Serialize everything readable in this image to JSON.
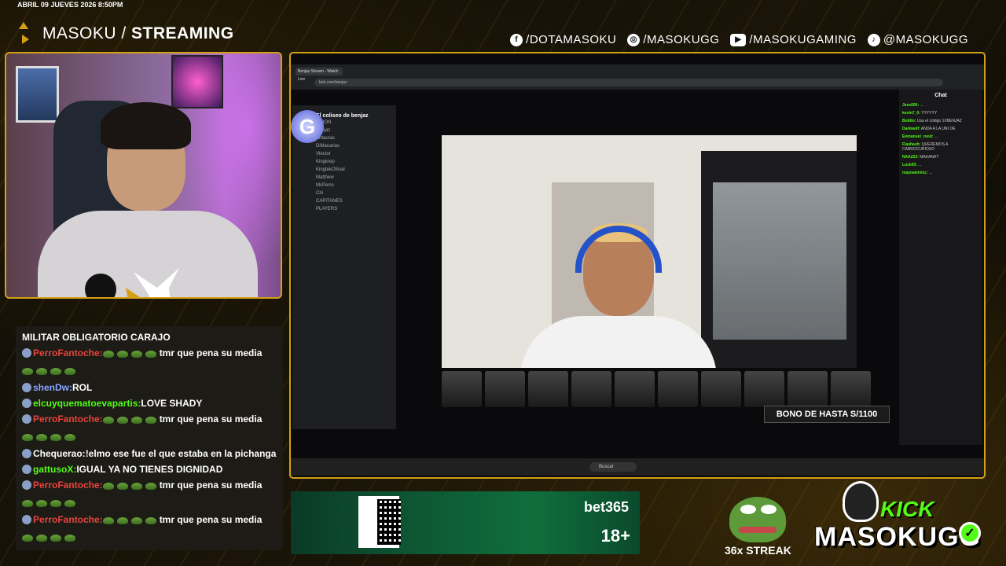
{
  "overlay": {
    "datetime": "ABRIL 09 JUEVES 2026 8:50PM",
    "brand_light": "MASOKU / ",
    "brand_bold": "STREAMING",
    "socials": [
      {
        "icon": "facebook-icon",
        "glyph": "f",
        "label": "/DOTAMASOKU"
      },
      {
        "icon": "instagram-icon",
        "glyph": "◎",
        "label": "/MASOKUGG"
      },
      {
        "icon": "youtube-icon",
        "glyph": "▶",
        "label": "/MASOKUGAMING"
      },
      {
        "icon": "tiktok-icon",
        "glyph": "♪",
        "label": "@MASOKUGG"
      }
    ]
  },
  "chat": {
    "messages": [
      {
        "user": "",
        "user_color": "#ffffff",
        "text": "MILITAR OBLIGATORIO CARAJO",
        "emotes": 0
      },
      {
        "user": "PerroFantoche:",
        "user_color": "#e8443c",
        "text": "tmr que pena su media",
        "emotes": 8
      },
      {
        "user": "shenDw:",
        "user_color": "#8aa6ff",
        "text": "ROL",
        "emotes": 0
      },
      {
        "user": "elcuyquematoevapartis:",
        "user_color": "#53fc18",
        "text": "LOVE SHADY",
        "emotes": 0
      },
      {
        "user": "PerroFantoche:",
        "user_color": "#e8443c",
        "text": "tmr que pena su media",
        "emotes": 8
      },
      {
        "user": "Chequerao:",
        "user_color": "#ffffff",
        "text": "!elmo ese fue el que estaba en la pichanga",
        "emotes": 0
      },
      {
        "user": "gattusoX:",
        "user_color": "#53fc18",
        "text": "IGUAL YA NO TIENES DIGNIDAD",
        "emotes": 0
      },
      {
        "user": "PerroFantoche:",
        "user_color": "#e8443c",
        "text": "tmr que pena su media",
        "emotes": 8
      },
      {
        "user": "PerroFantoche:",
        "user_color": "#e8443c",
        "text": "tmr que pena su media",
        "emotes": 8
      }
    ]
  },
  "screen": {
    "tab_title": "Benjaz Stream - Watch Live",
    "url": "kick.com/benjaz",
    "discord_server": "El coliseo de benjaz",
    "discord_channels": [
      "UNION",
      "Benjaz",
      "Antauras",
      "DiMacarias",
      "Vlector",
      "Kingkrep",
      "KingtekOficial",
      "Matthew",
      "McPerro",
      "Chi",
      "CAPITANES",
      "PLAYERS"
    ],
    "window_title": "El coliseo de benjaz",
    "promo_text": "BONO DE HASTA S/1100",
    "right_chat_header": "Chat",
    "right_chat_lines": [
      {
        "user": "Jess000:",
        "text": "..."
      },
      {
        "user": "kevin7_0:",
        "text": "YYYYYY"
      },
      {
        "user": "Botlito:",
        "text": "Usa el código 1XBENJAZ"
      },
      {
        "user": "Darkwolf:",
        "text": "ANDA A LA UNI OE"
      },
      {
        "user": "Enmanuel_rood:",
        "text": "..."
      },
      {
        "user": "Flashash:",
        "text": "QUEREMOS A CABROCURIOSO"
      },
      {
        "user": "NAA223:",
        "text": "MAKANA?"
      },
      {
        "user": "Luck00:",
        "text": "..."
      },
      {
        "user": "mayoalelvisc:",
        "text": "..."
      }
    ],
    "taskbar_search": "Buscar"
  },
  "banner": {
    "brand": "bet365",
    "age": "18+"
  },
  "streak": {
    "label": "36x STREAK"
  },
  "kick": {
    "word": "KICK",
    "name": "MASOKUGG"
  },
  "colors": {
    "accent_gold": "#d4a017",
    "kick_green": "#53fc18"
  }
}
